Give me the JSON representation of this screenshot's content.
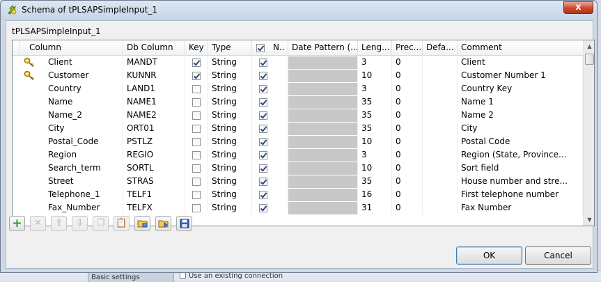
{
  "window": {
    "title": "Schema of tPLSAPSimpleInput_1",
    "close_label": "x"
  },
  "component_name": "tPLSAPSimpleInput_1",
  "table": {
    "headers": {
      "column": "Column",
      "db_column": "Db Column",
      "key": "Key",
      "type": "Type",
      "nullable": "N..",
      "date_pattern": "Date Pattern (...",
      "length": "Leng...",
      "precision": "Prec...",
      "default": "Defa...",
      "comment": "Comment"
    },
    "nullable_header_checked": true,
    "rows": [
      {
        "column": "Client",
        "db_column": "MANDT",
        "key": true,
        "type": "String",
        "nullable": true,
        "length": "3",
        "precision": "0",
        "comment": "Client"
      },
      {
        "column": "Customer",
        "db_column": "KUNNR",
        "key": true,
        "type": "String",
        "nullable": true,
        "length": "10",
        "precision": "0",
        "comment": "Customer Number 1"
      },
      {
        "column": "Country",
        "db_column": "LAND1",
        "key": false,
        "type": "String",
        "nullable": true,
        "length": "3",
        "precision": "0",
        "comment": "Country Key"
      },
      {
        "column": "Name",
        "db_column": "NAME1",
        "key": false,
        "type": "String",
        "nullable": true,
        "length": "35",
        "precision": "0",
        "comment": "Name 1"
      },
      {
        "column": "Name_2",
        "db_column": "NAME2",
        "key": false,
        "type": "String",
        "nullable": true,
        "length": "35",
        "precision": "0",
        "comment": "Name 2"
      },
      {
        "column": "City",
        "db_column": "ORT01",
        "key": false,
        "type": "String",
        "nullable": true,
        "length": "35",
        "precision": "0",
        "comment": "City"
      },
      {
        "column": "Postal_Code",
        "db_column": "PSTLZ",
        "key": false,
        "type": "String",
        "nullable": true,
        "length": "10",
        "precision": "0",
        "comment": "Postal Code"
      },
      {
        "column": "Region",
        "db_column": "REGIO",
        "key": false,
        "type": "String",
        "nullable": true,
        "length": "3",
        "precision": "0",
        "comment": "Region (State, Province..."
      },
      {
        "column": "Search_term",
        "db_column": "SORTL",
        "key": false,
        "type": "String",
        "nullable": true,
        "length": "10",
        "precision": "0",
        "comment": "Sort field"
      },
      {
        "column": "Street",
        "db_column": "STRAS",
        "key": false,
        "type": "String",
        "nullable": true,
        "length": "35",
        "precision": "0",
        "comment": "House number and stre..."
      },
      {
        "column": "Telephone_1",
        "db_column": "TELF1",
        "key": false,
        "type": "String",
        "nullable": true,
        "length": "16",
        "precision": "0",
        "comment": "First telephone number"
      },
      {
        "column": "Fax_Number",
        "db_column": "TELFX",
        "key": false,
        "type": "String",
        "nullable": true,
        "length": "31",
        "precision": "0",
        "comment": "Fax Number"
      }
    ]
  },
  "toolbar": {
    "buttons": [
      {
        "name": "add-row-button",
        "icon": "plus-icon",
        "glyph": "+",
        "enabled": true
      },
      {
        "name": "remove-row-button",
        "icon": "x-icon",
        "glyph": "✕",
        "enabled": false
      },
      {
        "name": "move-up-button",
        "icon": "arrow-up-icon",
        "glyph": "⇧",
        "enabled": false
      },
      {
        "name": "move-down-button",
        "icon": "arrow-down-icon",
        "glyph": "⇩",
        "enabled": false
      },
      {
        "name": "copy-button",
        "icon": "copy-icon",
        "glyph": "❐",
        "enabled": false
      },
      {
        "name": "paste-button",
        "icon": "paste-icon",
        "glyph": "📋",
        "enabled": false
      },
      {
        "name": "import-button",
        "icon": "folder-import-icon",
        "glyph": "",
        "enabled": true
      },
      {
        "name": "export-button",
        "icon": "folder-export-icon",
        "glyph": "",
        "enabled": true
      },
      {
        "name": "save-button",
        "icon": "floppy-disk-icon",
        "glyph": "",
        "enabled": true
      }
    ]
  },
  "buttons": {
    "ok": "OK",
    "cancel": "Cancel"
  },
  "background": {
    "tab": "Basic settings",
    "option": "Use an existing connection"
  }
}
